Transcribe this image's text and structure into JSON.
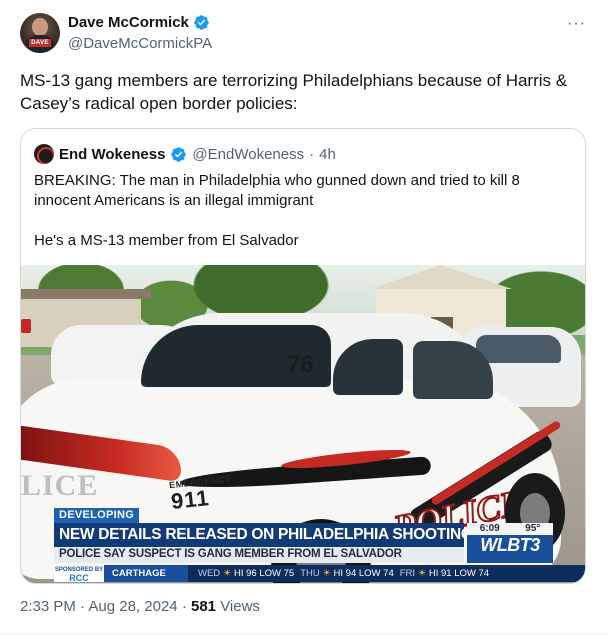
{
  "author": {
    "display_name": "Dave McCormick",
    "handle": "@DaveMcCormickPA",
    "avatar_badge": "DAVE",
    "verified": true
  },
  "more_label": "···",
  "tweet_text": "MS-13 gang members are terrorizing Philadelphians because of Harris & Casey’s radical open border policies:",
  "quote": {
    "display_name": "End Wokeness",
    "handle": "@EndWokeness",
    "separator": "·",
    "time": "4h",
    "paragraph_1": "BREAKING: The man in Philadelphia who gunned down and tried to kill 8 innocent Americans is an illegal immigrant",
    "paragraph_2": "He's a MS-13 member from El Salvador",
    "media": {
      "car_number": "76",
      "car_lice_text": "LICE",
      "car_emergency": "EMERGENCY",
      "car_911": "911",
      "car_police": "POLICE",
      "tag": "DEVELOPING",
      "headline": "NEW DETAILS RELEASED ON PHILADELPHIA SHOOTINGS",
      "subline": "POLICE SAY SUSPECT IS GANG MEMBER FROM EL SALVADOR",
      "clock": "6:09",
      "temperature": "95°",
      "station": "WLBT3",
      "sponsor_line": "SPONSORED BY",
      "sponsor_logo": "RCC",
      "ticker_city": "CARTHAGE",
      "forecast": [
        {
          "day": "WED",
          "text": "HI 96 LOW 75"
        },
        {
          "day": "THU",
          "text": "HI 94 LOW 74"
        },
        {
          "day": "FRI",
          "text": "HI 91 LOW 74"
        }
      ]
    }
  },
  "footer": {
    "time": "2:33 PM",
    "dot": "·",
    "date": "Aug 28, 2024",
    "views_count": "581",
    "views_label": "Views"
  },
  "colors": {
    "verified_blue": "#1d9bf0",
    "text_primary": "#0f1419",
    "text_secondary": "#536471",
    "news_blue": "#123a77"
  }
}
